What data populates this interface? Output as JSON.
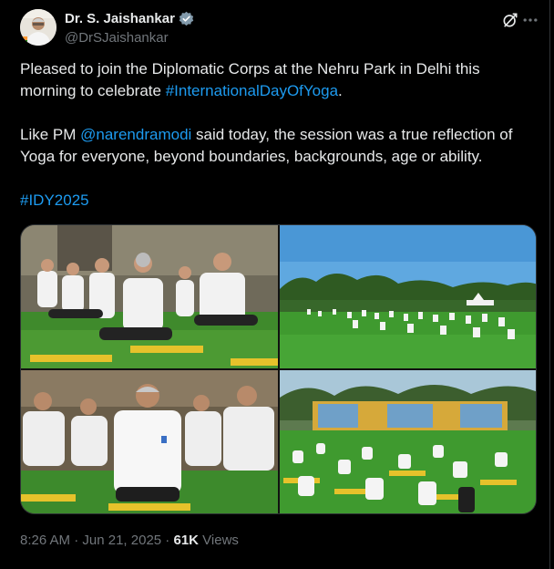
{
  "author": {
    "name": "Dr. S. Jaishankar",
    "handle": "@DrSJaishankar"
  },
  "post": {
    "line1_a": "Pleased to join the Diplomatic Corps at the Nehru Park in Delhi this",
    "line1_b": "morning to celebrate ",
    "hashtag1": "#InternationalDayOfYoga",
    "line1_end": ".",
    "line2_a": "Like PM ",
    "mention": "@narendramodi",
    "line2_b": " said today, the session was a true reflection of",
    "line2_c": "Yoga for everyone, beyond boundaries, backgrounds, age or ability.",
    "hashtag2": "#IDY2025"
  },
  "meta": {
    "time": "8:26 AM",
    "sep1": " · ",
    "date": "Jun 21, 2025",
    "sep2": " · ",
    "views_count": "61K",
    "views_label": " Views"
  },
  "colors": {
    "link": "#1d9bf0",
    "muted": "#71767b",
    "text": "#e7e9ea",
    "verified": "#829aab"
  },
  "icons": [
    "verified-badge-icon",
    "grok-icon",
    "more-options-icon"
  ]
}
